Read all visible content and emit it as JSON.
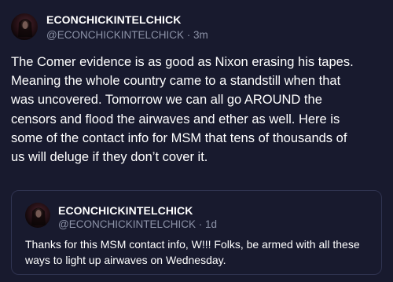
{
  "post": {
    "author": {
      "display_name": "ECONCHICKINTELCHICK",
      "handle": "@ECONCHICKINTELCHICK",
      "separator": " · ",
      "time": "3m"
    },
    "text": "The Comer evidence is as good as Nixon erasing his tapes.\nMeaning the whole country came to a standstill when that\nwas uncovered.  Tomorrow we can all go AROUND the\ncensors and flood the airwaves and ether as well. Here is\nsome of the contact info for MSM that tens of thousands of\nus will deluge if they don’t cover it."
  },
  "quote": {
    "author": {
      "display_name": "ECONCHICKINTELCHICK",
      "handle": "@ECONCHICKINTELCHICK",
      "separator": " · ",
      "time": "1d"
    },
    "text": "Thanks for this MSM contact info, W!!! Folks, be armed with all these ways to light up airwaves on Wednesday."
  },
  "colors": {
    "background": "#181a2e",
    "text": "#ffffff",
    "muted": "#8d93a8",
    "border": "#2f3350"
  }
}
